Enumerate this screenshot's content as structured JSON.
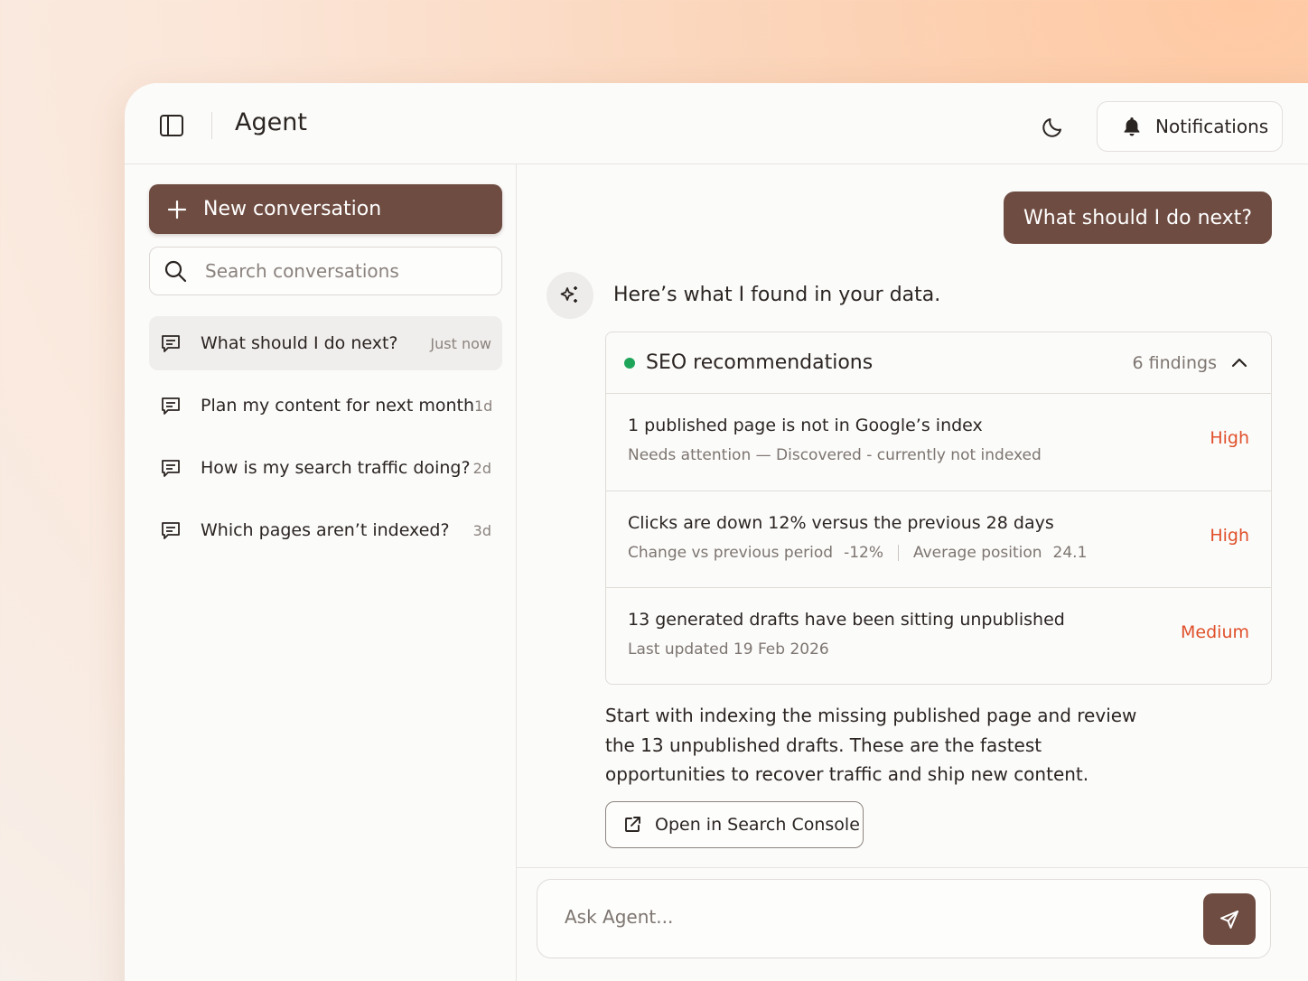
{
  "header": {
    "title": "Agent",
    "notifications_label": "Notifications",
    "sidebar_toggle_icon": "sidebar-panel-icon",
    "theme_icon": "moon-icon",
    "bell_icon": "bell-icon"
  },
  "sidebar": {
    "new_conversation_label": "New conversation",
    "search_placeholder": "Search conversations",
    "conversations": [
      {
        "title": "What should I do next?",
        "time": "Just now",
        "active": true
      },
      {
        "title": "Plan my content for next month",
        "time": "1d",
        "active": false
      },
      {
        "title": "How is my search traffic doing?",
        "time": "2d",
        "active": false
      },
      {
        "title": "Which pages aren’t indexed?",
        "time": "3d",
        "active": false
      }
    ]
  },
  "chat": {
    "user_message": "What should I do next?",
    "agent_intro": "Here’s what I found in your data.",
    "findings_card": {
      "title": "SEO recommendations",
      "count": "6 findings",
      "status_color": "#1fa55a",
      "items": [
        {
          "title": "1 published page is not in Google’s index",
          "subtitle": "Needs attention — Discovered - currently not indexed",
          "priority": "High"
        },
        {
          "title": "Clicks are down 12% versus the previous 28 days",
          "metric1_label": "Change vs previous period",
          "metric1_value": "-12%",
          "metric2_label": "Average position",
          "metric2_value": "24.1",
          "priority": "High"
        },
        {
          "title": "13 generated drafts have been sitting unpublished",
          "subtitle": "Last updated 19 Feb 2026",
          "priority": "Medium"
        }
      ]
    },
    "summary": "Start with indexing the missing published page and review the 13 unpublished drafts. These are the fastest opportunities to recover traffic and ship new content.",
    "open_console_label": "Open in Search Console"
  },
  "composer": {
    "placeholder": "Ask Agent..."
  },
  "colors": {
    "accent": "#6e4c41",
    "priority": "#e0502a",
    "status_green": "#1fa55a"
  }
}
